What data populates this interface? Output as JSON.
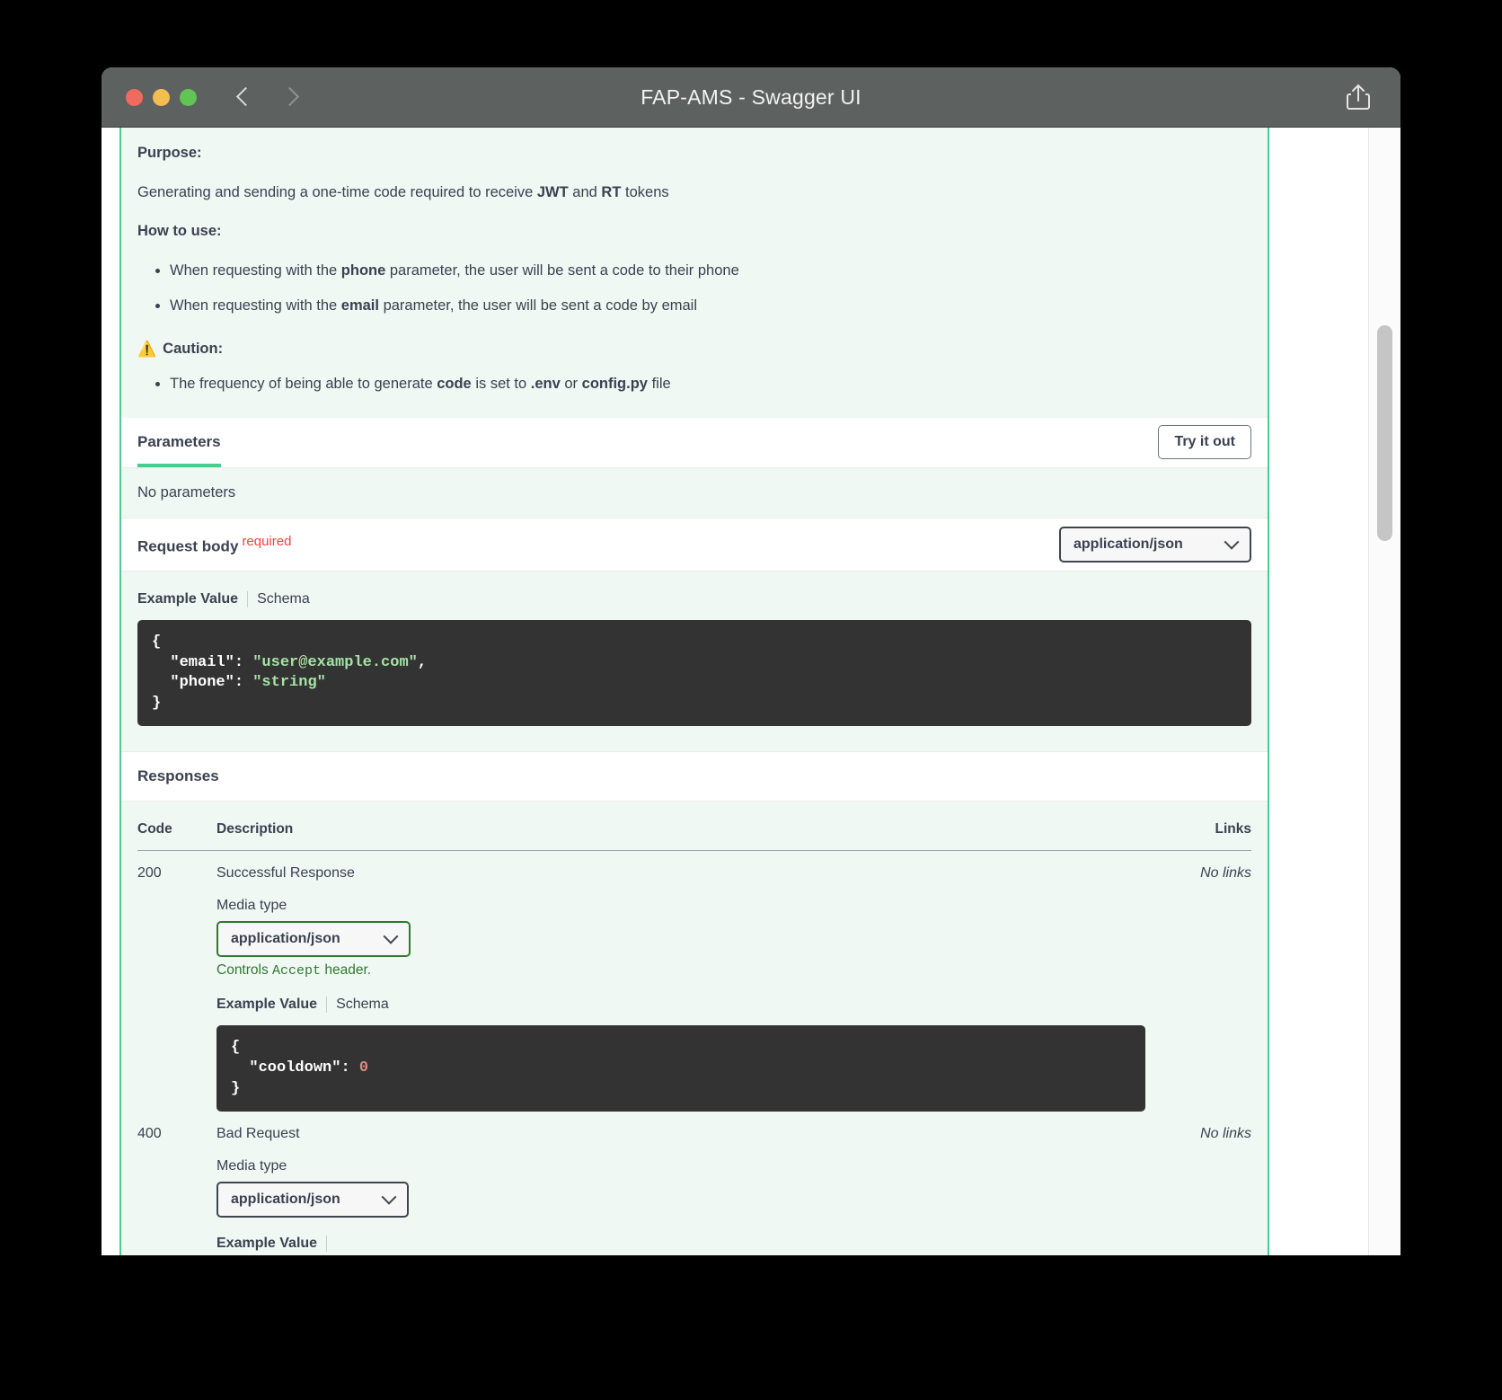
{
  "window": {
    "title": "FAP-AMS - Swagger UI",
    "traffic_lights": [
      "close",
      "minimize",
      "zoom"
    ],
    "back_label": "Back",
    "forward_label": "Forward",
    "share_label": "Share"
  },
  "description": {
    "purpose_heading": "Purpose:",
    "purpose_text_before": "Generating and sending a one-time code required to receive ",
    "purpose_bold_1": "JWT",
    "purpose_text_mid": " and ",
    "purpose_bold_2": "RT",
    "purpose_text_after": " tokens",
    "howto_heading": "How to use:",
    "howto_items": [
      {
        "before": "When requesting with the ",
        "bold": "phone",
        "after": " parameter, the user will be sent a code to their phone"
      },
      {
        "before": "When requesting with the ",
        "bold": "email",
        "after": " parameter, the user will be sent a code by email"
      }
    ],
    "caution_icon": "⚠️",
    "caution_heading": "Caution:",
    "caution_items": [
      {
        "before": "The frequency of being able to generate ",
        "bold": "code",
        "mid": " is set to ",
        "bold2": ".env",
        "mid2": " or ",
        "bold3": "config.py",
        "after": " file"
      }
    ]
  },
  "parameters": {
    "title": "Parameters",
    "try_it_out_label": "Try it out",
    "empty_text": "No parameters"
  },
  "request_body": {
    "label": "Request body",
    "required_label": "required",
    "media_type": "application/json",
    "tab_example": "Example Value",
    "tab_schema": "Schema",
    "example_lines": [
      {
        "text": "{"
      },
      {
        "text": "  \"email\": ",
        "value": "\"user@example.com\"",
        "suffix": ","
      },
      {
        "text": "  \"phone\": ",
        "value": "\"string\"",
        "suffix": ""
      },
      {
        "text": "}"
      }
    ],
    "example_raw": "{\n  \"email\": \"user@example.com\",\n  \"phone\": \"string\"\n}"
  },
  "responses": {
    "title": "Responses",
    "columns": {
      "code": "Code",
      "description": "Description",
      "links": "Links"
    },
    "rows": [
      {
        "code": "200",
        "description": "Successful Response",
        "links": "No links",
        "media_type_label": "Media type",
        "media_type": "application/json",
        "accept_note_before": "Controls ",
        "accept_note_code": "Accept",
        "accept_note_after": " header.",
        "tab_example": "Example Value",
        "tab_schema": "Schema",
        "example_raw": "{\n  \"cooldown\": 0\n}",
        "example_key": "  \"cooldown\": ",
        "example_value": "0"
      },
      {
        "code": "400",
        "description": "Bad Request",
        "links": "No links",
        "media_type_label": "Media type",
        "media_type": "application/json",
        "tab_example": "Example Value"
      }
    ]
  },
  "colors": {
    "accent_green": "#49cc90",
    "panel_bg": "#f0f8f3",
    "required_red": "#f93e3e",
    "code_bg": "#333333",
    "string_green": "#a5e2a5",
    "number_red": "#d98a82",
    "titlebar": "#5d6160"
  },
  "scrollbar": {
    "position_label": "vertical-scrollbar"
  }
}
